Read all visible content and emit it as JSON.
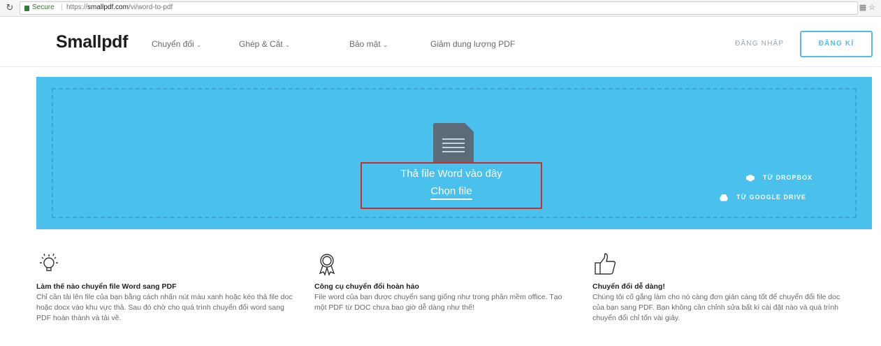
{
  "browser": {
    "secure_label": "Secure",
    "separator": "|",
    "url_prefix": "https://",
    "url_domain": "smallpdf.com",
    "url_path": "/vi/word-to-pdf"
  },
  "header": {
    "logo": "Smallpdf",
    "nav": [
      {
        "label": "Chuyển đổi"
      },
      {
        "label": "Ghép & Cắt"
      },
      {
        "label": "Bảo mật"
      },
      {
        "label": "Giảm dung lượng PDF"
      }
    ],
    "login_label": "ĐĂNG NHẬP",
    "signup_label": "ĐĂNG KÍ"
  },
  "dropzone": {
    "title": "Thả file Word vào đây",
    "choose_label": "Chọn file",
    "dropbox_label": "TỪ DROPBOX",
    "gdrive_label": "TỪ GOOGLE DRIVE",
    "bg_color": "#4ac0ec"
  },
  "features": [
    {
      "title": "Làm thế nào chuyển file Word sang PDF",
      "text": "Chỉ cần tải lên file của bạn bằng cách nhấn nút màu xanh hoặc kéo thả file doc hoặc docx vào khu vực thả. Sau đó chờ cho quá trình chuyển đổi word sang PDF hoàn thành và tải về."
    },
    {
      "title": "Công cụ chuyển đổi hoàn hảo",
      "text": "File word của bạn được chuyển sang giống như trong phần mềm office. Tạo một PDF từ DOC chưa bao giờ dễ dàng như thế!"
    },
    {
      "title": "Chuyển đổi dễ dàng!",
      "text": "Chúng tôi cố gắng làm cho nó càng đơn giản càng tốt để chuyển đổi file doc của bạn sang PDF. Bạn không cần chỉnh sửa bất kì cài đặt nào và quá trình chuyển đổi chỉ tốn vài giây."
    }
  ]
}
